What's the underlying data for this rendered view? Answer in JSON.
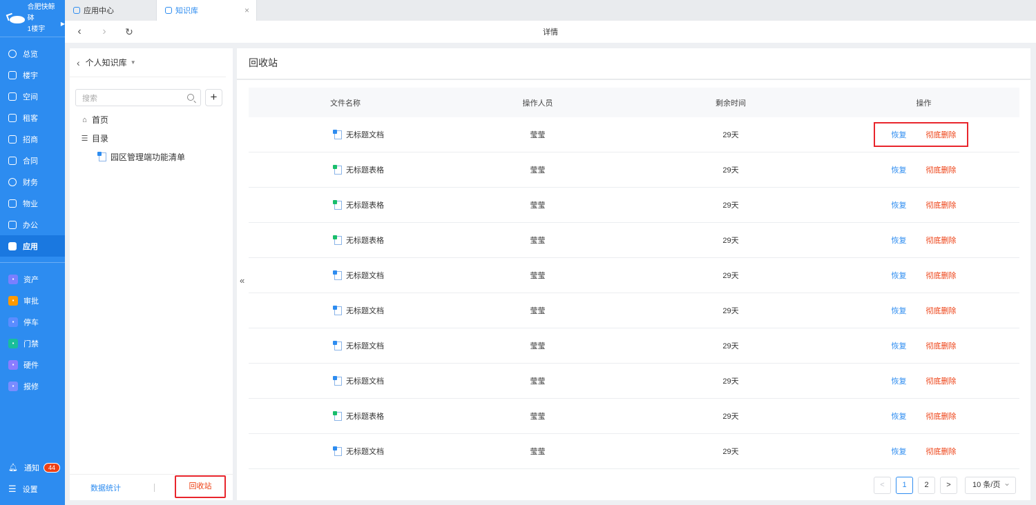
{
  "brand": {
    "name": "合肥快鲸砵",
    "building": "1楼宇"
  },
  "nav": {
    "items": [
      {
        "label": "总览",
        "icon": "dashboard-icon"
      },
      {
        "label": "楼宇",
        "icon": "building-icon"
      },
      {
        "label": "空间",
        "icon": "cube-icon"
      },
      {
        "label": "租客",
        "icon": "tenant-icon"
      },
      {
        "label": "招商",
        "icon": "tag-icon"
      },
      {
        "label": "合同",
        "icon": "contract-icon"
      },
      {
        "label": "财务",
        "icon": "finance-icon"
      },
      {
        "label": "物业",
        "icon": "home-icon"
      },
      {
        "label": "办公",
        "icon": "monitor-icon"
      },
      {
        "label": "应用",
        "icon": "app-icon"
      }
    ],
    "apps": [
      {
        "label": "资产",
        "color": "#7a7fff"
      },
      {
        "label": "审批",
        "color": "#ff9900"
      },
      {
        "label": "停车",
        "color": "#5b8cff"
      },
      {
        "label": "门禁",
        "color": "#19be9b"
      },
      {
        "label": "硬件",
        "color": "#8a7cff"
      },
      {
        "label": "报修",
        "color": "#7a8cff"
      }
    ],
    "notify": {
      "label": "通知",
      "count": "44"
    },
    "settings": {
      "label": "设置"
    }
  },
  "tabs": [
    {
      "label": "应用中心"
    },
    {
      "label": "知识库",
      "close": "×"
    }
  ],
  "toolbar": {
    "title": "详情",
    "back": "‹",
    "forward": "›",
    "refresh": "↻"
  },
  "left_panel": {
    "title": "个人知识库",
    "search_placeholder": "搜索",
    "add": "+",
    "tree": [
      {
        "label": "首页"
      },
      {
        "label": "目录"
      },
      {
        "label": "园区管理端功能清单"
      }
    ],
    "footer": {
      "stats": "数据统计",
      "recycle": "回收站"
    }
  },
  "collapse": "«",
  "main": {
    "title": "回收站",
    "columns": [
      "文件名称",
      "操作人员",
      "剩余时间",
      "操作"
    ],
    "rows": [
      {
        "name": "无标题文档",
        "type": "doc",
        "user": "莹莹",
        "remaining": "29天"
      },
      {
        "name": "无标题表格",
        "type": "sheet",
        "user": "莹莹",
        "remaining": "29天"
      },
      {
        "name": "无标题表格",
        "type": "sheet",
        "user": "莹莹",
        "remaining": "29天"
      },
      {
        "name": "无标题表格",
        "type": "sheet",
        "user": "莹莹",
        "remaining": "29天"
      },
      {
        "name": "无标题文档",
        "type": "doc",
        "user": "莹莹",
        "remaining": "29天"
      },
      {
        "name": "无标题文档",
        "type": "doc",
        "user": "莹莹",
        "remaining": "29天"
      },
      {
        "name": "无标题文档",
        "type": "doc",
        "user": "莹莹",
        "remaining": "29天"
      },
      {
        "name": "无标题文档",
        "type": "doc",
        "user": "莹莹",
        "remaining": "29天"
      },
      {
        "name": "无标题表格",
        "type": "sheet",
        "user": "莹莹",
        "remaining": "29天"
      },
      {
        "name": "无标题文档",
        "type": "doc",
        "user": "莹莹",
        "remaining": "29天"
      }
    ],
    "actions": {
      "restore": "恢复",
      "purge": "彻底删除"
    },
    "pager": {
      "prev": "<",
      "pages": [
        "1",
        "2"
      ],
      "next": ">",
      "size": "10 条/页"
    }
  },
  "colors": {
    "primary": "#2d8cf0",
    "danger": "#ed4014",
    "highlight": "#e8242b"
  }
}
